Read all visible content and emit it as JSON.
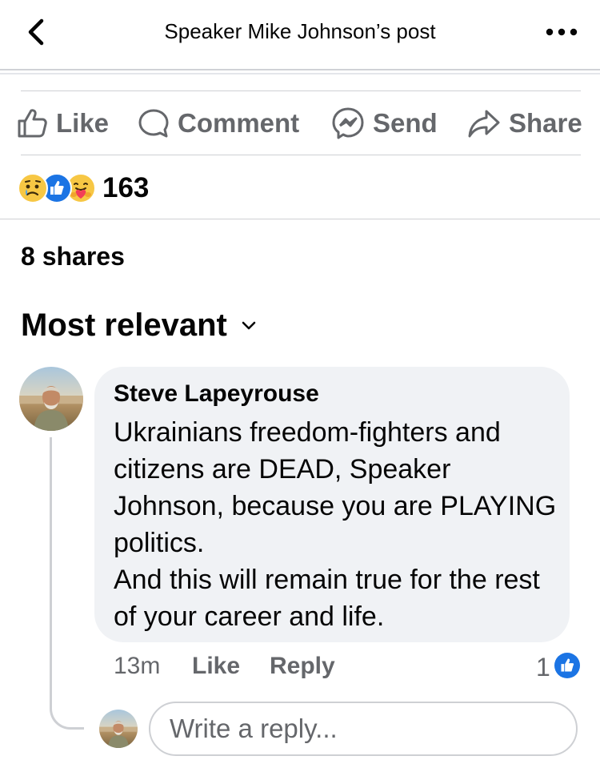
{
  "header": {
    "title": "Speaker Mike Johnson’s post",
    "back_icon": "chevron-left-icon",
    "more_icon": "more-horizontal-icon"
  },
  "actions": {
    "like_label": "Like",
    "comment_label": "Comment",
    "send_label": "Send",
    "share_label": "Share"
  },
  "reactions": {
    "icons": [
      "sad-reaction-icon",
      "like-reaction-icon",
      "care-reaction-icon"
    ],
    "count": "163"
  },
  "shares": "8 shares",
  "sort": {
    "label": "Most relevant",
    "icon": "chevron-down-icon"
  },
  "comment": {
    "author": "Steve Lapeyrouse",
    "text": "Ukrainians freedom-fighters and citizens are DEAD, Speaker Johnson, because you are PLAYING politics.\nAnd this will remain true for the rest of your career and life.",
    "time": "13m",
    "like_label": "Like",
    "reply_label": "Reply",
    "like_count": "1"
  },
  "reply_box": {
    "placeholder": "Write a reply..."
  },
  "colors": {
    "muted_text": "#65676b",
    "bubble_bg": "#f0f2f5",
    "divider": "#ced0d4",
    "like_blue": "#1b74e4"
  }
}
